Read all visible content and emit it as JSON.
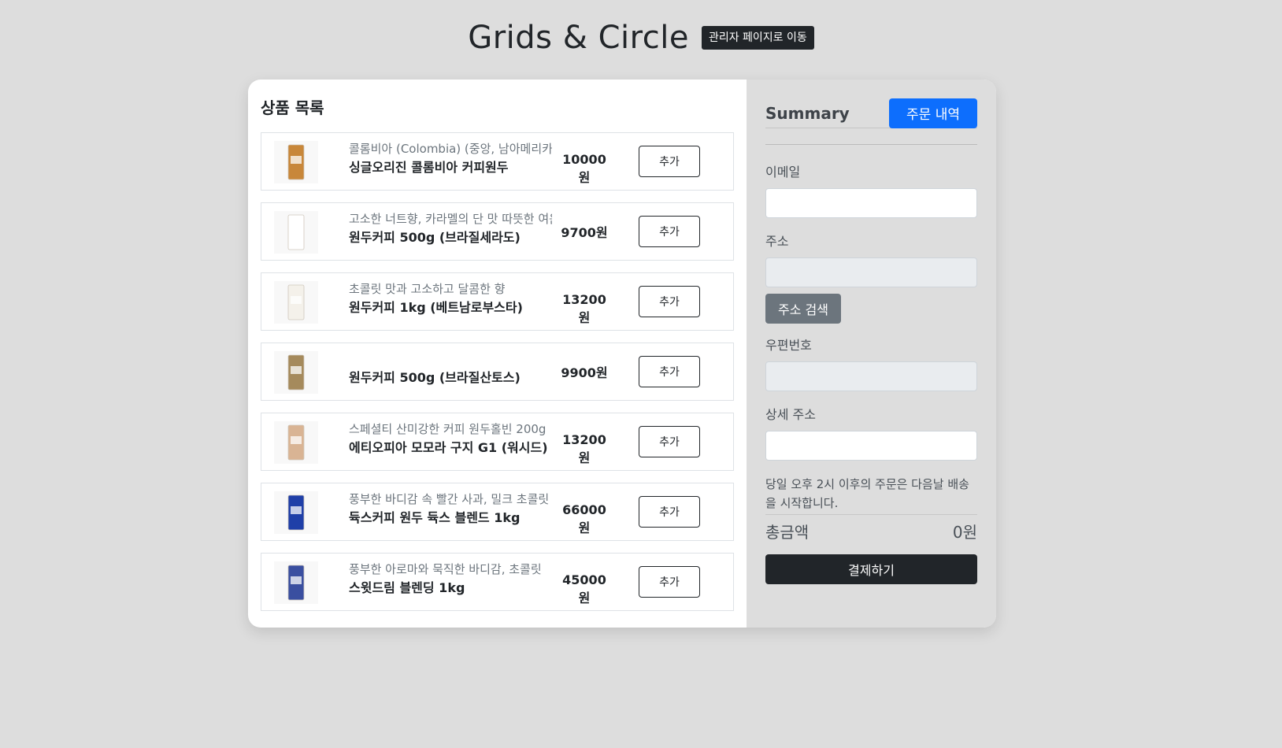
{
  "header": {
    "title": "Grids & Circle",
    "admin_button": "관리자 페이지로 이동"
  },
  "products": {
    "title": "상품 목록",
    "add_label": "추가",
    "items": [
      {
        "desc": "콜롬비아 (Colombia) (중앙, 남아메리카)",
        "name": "싱글오리진 콜롬비아 커피원두",
        "price": "10000원",
        "color": "#c8873a"
      },
      {
        "desc": "고소한 너트향, 카라멜의 단 맛 따뜻한 여운",
        "name": "원두커피 500g (브라질세라도)",
        "price": "9700원",
        "color": "#ffffff"
      },
      {
        "desc": "초콜릿 맛과 고소하고 달콤한 향",
        "name": "원두커피 1kg (베트남로부스타)",
        "price": "13200원",
        "color": "#f4f1ea"
      },
      {
        "desc": "",
        "name": "원두커피 500g (브라질산토스)",
        "price": "9900원",
        "color": "#a58a5c"
      },
      {
        "desc": "스페셜티 산미강한 커피 원두홀빈 200g",
        "name": "에티오피아 모모라 구지 G1 (워시드)",
        "price": "13200원",
        "color": "#d9b494"
      },
      {
        "desc": "풍부한 바디감 속 빨간 사과, 밀크 초콜릿",
        "name": "듁스커피 원두 듁스 블렌드 1kg",
        "price": "66000원",
        "color": "#1f3fa8"
      },
      {
        "desc": "풍부한 아로마와 묵직한 바디감, 초콜릿",
        "name": "스윗드림 블렌딩 1kg",
        "price": "45000원",
        "color": "#3a4fa0"
      }
    ]
  },
  "summary": {
    "title": "Summary",
    "order_history_button": "주문 내역",
    "email_label": "이메일",
    "address_label": "주소",
    "address_search_button": "주소 검색",
    "zipcode_label": "우편번호",
    "detail_address_label": "상세 주소",
    "notice": "당일 오후 2시 이후의 주문은 다음날 배송을 시작합니다.",
    "total_label": "총금액",
    "total_value": "0원",
    "pay_button": "결제하기"
  }
}
